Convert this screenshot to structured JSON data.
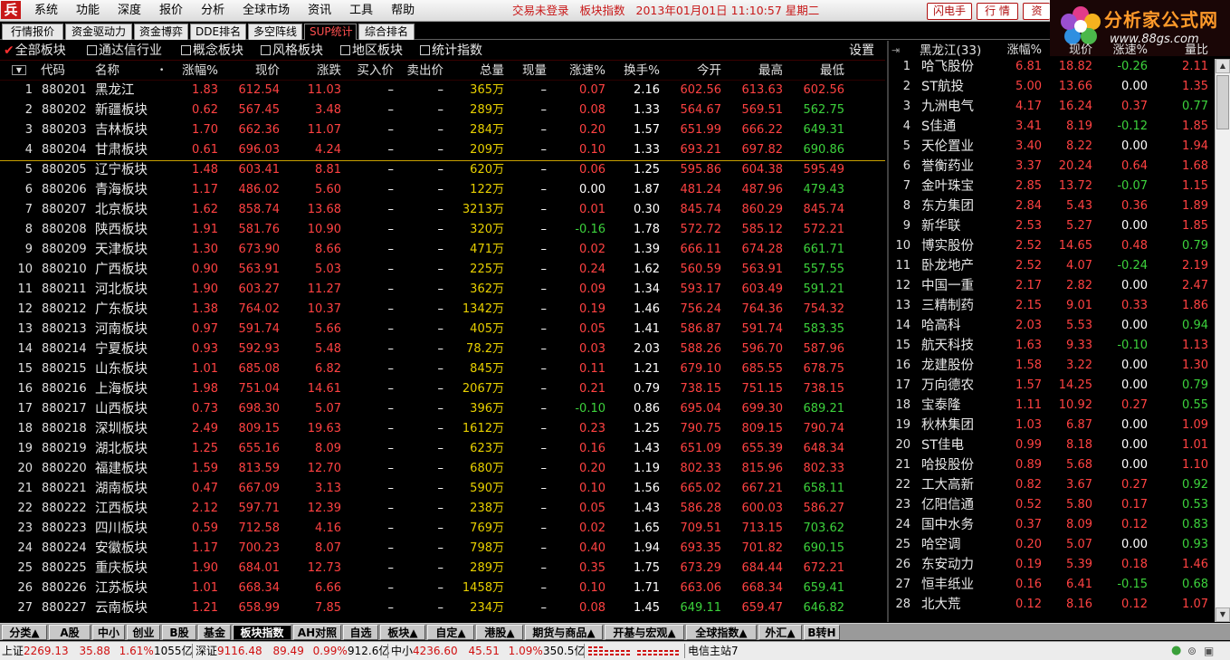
{
  "titlebar": {
    "logo": "兵",
    "menu": [
      "系统",
      "功能",
      "深度",
      "报价",
      "分析",
      "全球市场",
      "资讯",
      "工具",
      "帮助"
    ],
    "login_status": "交易未登录",
    "view_name": "板块指数",
    "datetime": "2013年01月01日 11:10:57 星期二",
    "btn_flash": "闪电手",
    "btn_quote": "行 情",
    "btn_info": "资"
  },
  "brand": {
    "title": "分析家公式网",
    "url": "www.88gs.com"
  },
  "top_tabs": [
    "行情报价",
    "资金驱动力",
    "资金博弈",
    "DDE排名",
    "多空阵线",
    "SUP统计",
    "综合排名"
  ],
  "top_tab_active": 5,
  "filters": {
    "items": [
      "全部板块",
      "通达信行业",
      "概念板块",
      "风格板块",
      "地区板块",
      "统计指数"
    ],
    "checked": 0,
    "settings": "设置"
  },
  "main_table": {
    "headers": [
      "",
      "代码",
      "名称",
      "•",
      "涨幅%",
      "现价",
      "涨跌",
      "买入价",
      "卖出价",
      "总量",
      "现量",
      "涨速%",
      "换手%",
      "今开",
      "最高",
      "最低"
    ],
    "rows": [
      [
        "1",
        "880201",
        "黑龙江",
        "1.83",
        "612.54",
        "11.03",
        "–",
        "–",
        "365万",
        "–",
        "0.07",
        "2.16",
        "602.56",
        "613.63",
        "602.56"
      ],
      [
        "2",
        "880202",
        "新疆板块",
        "0.62",
        "567.45",
        "3.48",
        "–",
        "–",
        "289万",
        "–",
        "0.08",
        "1.33",
        "564.67",
        "569.51",
        "562.75"
      ],
      [
        "3",
        "880203",
        "吉林板块",
        "1.70",
        "662.36",
        "11.07",
        "–",
        "–",
        "284万",
        "–",
        "0.20",
        "1.57",
        "651.99",
        "666.22",
        "649.31"
      ],
      [
        "4",
        "880204",
        "甘肃板块",
        "0.61",
        "696.03",
        "4.24",
        "–",
        "–",
        "209万",
        "–",
        "0.10",
        "1.33",
        "693.21",
        "697.82",
        "690.86"
      ],
      [
        "5",
        "880205",
        "辽宁板块",
        "1.48",
        "603.41",
        "8.81",
        "–",
        "–",
        "620万",
        "–",
        "0.06",
        "1.25",
        "595.86",
        "604.38",
        "595.49"
      ],
      [
        "6",
        "880206",
        "青海板块",
        "1.17",
        "486.02",
        "5.60",
        "–",
        "–",
        "122万",
        "–",
        "0.00",
        "1.87",
        "481.24",
        "487.96",
        "479.43"
      ],
      [
        "7",
        "880207",
        "北京板块",
        "1.62",
        "858.74",
        "13.68",
        "–",
        "–",
        "3213万",
        "–",
        "0.01",
        "0.30",
        "845.74",
        "860.29",
        "845.74"
      ],
      [
        "8",
        "880208",
        "陕西板块",
        "1.91",
        "581.76",
        "10.90",
        "–",
        "–",
        "320万",
        "–",
        "-0.16",
        "1.78",
        "572.72",
        "585.12",
        "572.21"
      ],
      [
        "9",
        "880209",
        "天津板块",
        "1.30",
        "673.90",
        "8.66",
        "–",
        "–",
        "471万",
        "–",
        "0.02",
        "1.39",
        "666.11",
        "674.28",
        "661.71"
      ],
      [
        "10",
        "880210",
        "广西板块",
        "0.90",
        "563.91",
        "5.03",
        "–",
        "–",
        "225万",
        "–",
        "0.24",
        "1.62",
        "560.59",
        "563.91",
        "557.55"
      ],
      [
        "11",
        "880211",
        "河北板块",
        "1.90",
        "603.27",
        "11.27",
        "–",
        "–",
        "362万",
        "–",
        "0.09",
        "1.34",
        "593.17",
        "603.49",
        "591.21"
      ],
      [
        "12",
        "880212",
        "广东板块",
        "1.38",
        "764.02",
        "10.37",
        "–",
        "–",
        "1342万",
        "–",
        "0.19",
        "1.46",
        "756.24",
        "764.36",
        "754.32"
      ],
      [
        "13",
        "880213",
        "河南板块",
        "0.97",
        "591.74",
        "5.66",
        "–",
        "–",
        "405万",
        "–",
        "0.05",
        "1.41",
        "586.87",
        "591.74",
        "583.35"
      ],
      [
        "14",
        "880214",
        "宁夏板块",
        "0.93",
        "592.93",
        "5.48",
        "–",
        "–",
        "78.2万",
        "–",
        "0.03",
        "2.03",
        "588.26",
        "596.70",
        "587.96"
      ],
      [
        "15",
        "880215",
        "山东板块",
        "1.01",
        "685.08",
        "6.82",
        "–",
        "–",
        "845万",
        "–",
        "0.11",
        "1.21",
        "679.10",
        "685.55",
        "678.75"
      ],
      [
        "16",
        "880216",
        "上海板块",
        "1.98",
        "751.04",
        "14.61",
        "–",
        "–",
        "2067万",
        "–",
        "0.21",
        "0.79",
        "738.15",
        "751.15",
        "738.15"
      ],
      [
        "17",
        "880217",
        "山西板块",
        "0.73",
        "698.30",
        "5.07",
        "–",
        "–",
        "396万",
        "–",
        "-0.10",
        "0.86",
        "695.04",
        "699.30",
        "689.21"
      ],
      [
        "18",
        "880218",
        "深圳板块",
        "2.49",
        "809.15",
        "19.63",
        "–",
        "–",
        "1612万",
        "–",
        "0.23",
        "1.25",
        "790.75",
        "809.15",
        "790.74"
      ],
      [
        "19",
        "880219",
        "湖北板块",
        "1.25",
        "655.16",
        "8.09",
        "–",
        "–",
        "623万",
        "–",
        "0.16",
        "1.43",
        "651.09",
        "655.39",
        "648.34"
      ],
      [
        "20",
        "880220",
        "福建板块",
        "1.59",
        "813.59",
        "12.70",
        "–",
        "–",
        "680万",
        "–",
        "0.20",
        "1.19",
        "802.33",
        "815.96",
        "802.33"
      ],
      [
        "21",
        "880221",
        "湖南板块",
        "0.47",
        "667.09",
        "3.13",
        "–",
        "–",
        "590万",
        "–",
        "0.10",
        "1.56",
        "665.02",
        "667.21",
        "658.11"
      ],
      [
        "22",
        "880222",
        "江西板块",
        "2.12",
        "597.71",
        "12.39",
        "–",
        "–",
        "238万",
        "–",
        "0.05",
        "1.43",
        "586.28",
        "600.03",
        "586.27"
      ],
      [
        "23",
        "880223",
        "四川板块",
        "0.59",
        "712.58",
        "4.16",
        "–",
        "–",
        "769万",
        "–",
        "0.02",
        "1.65",
        "709.51",
        "713.15",
        "703.62"
      ],
      [
        "24",
        "880224",
        "安徽板块",
        "1.17",
        "700.23",
        "8.07",
        "–",
        "–",
        "798万",
        "–",
        "0.40",
        "1.94",
        "693.35",
        "701.82",
        "690.15"
      ],
      [
        "25",
        "880225",
        "重庆板块",
        "1.90",
        "684.01",
        "12.73",
        "–",
        "–",
        "289万",
        "–",
        "0.35",
        "1.75",
        "673.29",
        "684.44",
        "672.21"
      ],
      [
        "26",
        "880226",
        "江苏板块",
        "1.01",
        "668.34",
        "6.66",
        "–",
        "–",
        "1458万",
        "–",
        "0.10",
        "1.71",
        "663.06",
        "668.34",
        "659.41"
      ],
      [
        "27",
        "880227",
        "云南板块",
        "1.21",
        "658.99",
        "7.85",
        "–",
        "–",
        "234万",
        "–",
        "0.08",
        "1.45",
        "649.11",
        "659.47",
        "646.82"
      ]
    ]
  },
  "right_panel": {
    "title": "黑龙江(33)",
    "headers": [
      "涨幅%",
      "现价",
      "涨速%",
      "量比"
    ],
    "rows": [
      [
        "1",
        "哈飞股份",
        "6.81",
        "18.82",
        "-0.26",
        "2.11"
      ],
      [
        "2",
        "ST航投",
        "5.00",
        "13.66",
        "0.00",
        "1.35"
      ],
      [
        "3",
        "九洲电气",
        "4.17",
        "16.24",
        "0.37",
        "0.77"
      ],
      [
        "4",
        "S佳通",
        "3.41",
        "8.19",
        "-0.12",
        "1.85"
      ],
      [
        "5",
        "天伦置业",
        "3.40",
        "8.22",
        "0.00",
        "1.94"
      ],
      [
        "6",
        "誉衡药业",
        "3.37",
        "20.24",
        "0.64",
        "1.68"
      ],
      [
        "7",
        "金叶珠宝",
        "2.85",
        "13.72",
        "-0.07",
        "1.15"
      ],
      [
        "8",
        "东方集团",
        "2.84",
        "5.43",
        "0.36",
        "1.89"
      ],
      [
        "9",
        "新华联",
        "2.53",
        "5.27",
        "0.00",
        "1.85"
      ],
      [
        "10",
        "博实股份",
        "2.52",
        "14.65",
        "0.48",
        "0.79"
      ],
      [
        "11",
        "卧龙地产",
        "2.52",
        "4.07",
        "-0.24",
        "2.19"
      ],
      [
        "12",
        "中国一重",
        "2.17",
        "2.82",
        "0.00",
        "2.47"
      ],
      [
        "13",
        "三精制药",
        "2.15",
        "9.01",
        "0.33",
        "1.86"
      ],
      [
        "14",
        "哈高科",
        "2.03",
        "5.53",
        "0.00",
        "0.94"
      ],
      [
        "15",
        "航天科技",
        "1.63",
        "9.33",
        "-0.10",
        "1.13"
      ],
      [
        "16",
        "龙建股份",
        "1.58",
        "3.22",
        "0.00",
        "1.30"
      ],
      [
        "17",
        "万向德农",
        "1.57",
        "14.25",
        "0.00",
        "0.79"
      ],
      [
        "18",
        "宝泰隆",
        "1.11",
        "10.92",
        "0.27",
        "0.55"
      ],
      [
        "19",
        "秋林集团",
        "1.03",
        "6.87",
        "0.00",
        "1.09"
      ],
      [
        "20",
        "ST佳电",
        "0.99",
        "8.18",
        "0.00",
        "1.01"
      ],
      [
        "21",
        "哈投股份",
        "0.89",
        "5.68",
        "0.00",
        "1.10"
      ],
      [
        "22",
        "工大高新",
        "0.82",
        "3.67",
        "0.27",
        "0.92"
      ],
      [
        "23",
        "亿阳信通",
        "0.52",
        "5.80",
        "0.17",
        "0.53"
      ],
      [
        "24",
        "国中水务",
        "0.37",
        "8.09",
        "0.12",
        "0.83"
      ],
      [
        "25",
        "哈空调",
        "0.20",
        "5.07",
        "0.00",
        "0.93"
      ],
      [
        "26",
        "东安动力",
        "0.19",
        "5.39",
        "0.18",
        "1.46"
      ],
      [
        "27",
        "恒丰纸业",
        "0.16",
        "6.41",
        "-0.15",
        "0.68"
      ],
      [
        "28",
        "北大荒",
        "0.12",
        "8.16",
        "0.12",
        "1.07"
      ]
    ]
  },
  "bottom_tabs": [
    "分类▲",
    "A股",
    "中小",
    "创业",
    "B股",
    "基金",
    "板块指数",
    "AH对照",
    "自选",
    "板块▲",
    "自定▲",
    "港股▲",
    "期货与商品▲",
    "开基与宏观▲",
    "全球指数▲",
    "外汇▲",
    "B转H"
  ],
  "bottom_tab_active": 6,
  "statusbar": {
    "sh_label": "上证",
    "sh_value": "2269.13",
    "sh_change": "35.88",
    "sh_pct": "1.61%",
    "sh_amount": "1055亿",
    "sz_label": "深证",
    "sz_value": "9116.48",
    "sz_change": "89.49",
    "sz_pct": "0.99%",
    "sz_amount": "912.6亿",
    "zx_label": "中小",
    "zx_value": "4236.60",
    "zx_change": "45.51",
    "zx_pct": "1.09%",
    "zx_amount": "350.5亿",
    "server": "电信主站7"
  },
  "colors": {
    "up": "#ff4242",
    "down": "#3cd23c",
    "flat": "#ffffff",
    "volume": "#e8d000",
    "accent": "#c81818"
  }
}
